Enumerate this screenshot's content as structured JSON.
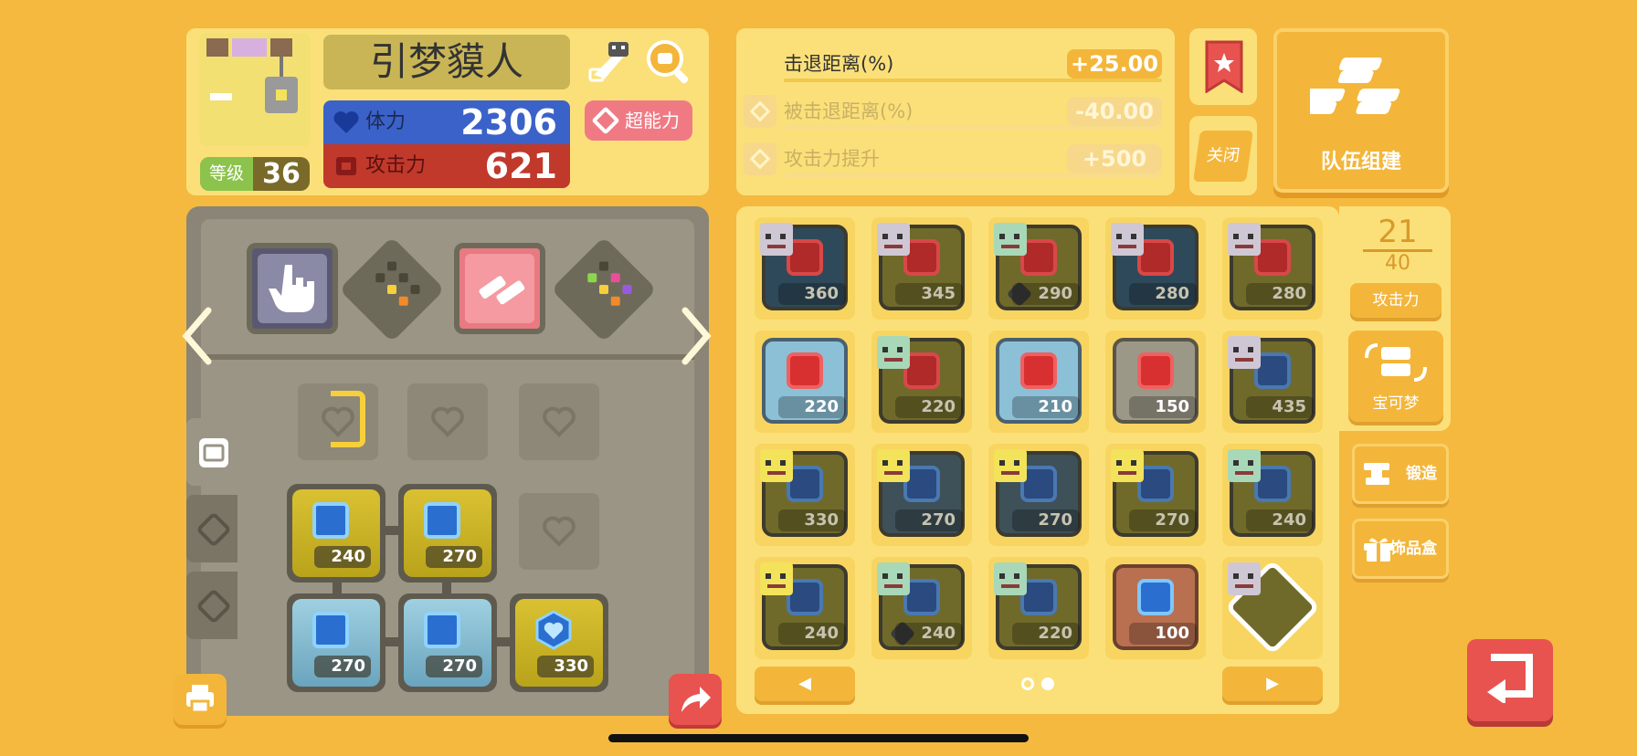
{
  "profile": {
    "name": "引梦貘人",
    "level_label": "等级",
    "level": "36",
    "hp_label": "体力",
    "hp": "2306",
    "atk_label": "攻击力",
    "atk": "621",
    "psychic_label": "超能力"
  },
  "skills": [
    {
      "label": "击退距离(%)",
      "value": "+25.00",
      "active": true
    },
    {
      "label": "被击退距离(%)",
      "value": "-40.00",
      "active": false
    },
    {
      "label": "攻击力提升",
      "value": "+500",
      "active": false
    }
  ],
  "buttons": {
    "close": "关闭",
    "team_build": "队伍组建",
    "attack_sort": "攻击力",
    "pokemon": "宝可梦",
    "forge": "锻造",
    "accessory_box": "饰品盒",
    "prev_page": "◀",
    "next_page": "▶"
  },
  "slot_counter": {
    "used": "21",
    "total": "40"
  },
  "board": {
    "equipped": [
      {
        "value": "240",
        "type": "gold"
      },
      {
        "value": "270",
        "type": "gold"
      },
      {
        "value": "270",
        "type": "blue"
      },
      {
        "value": "270",
        "type": "blue"
      },
      {
        "value": "330",
        "type": "gold-hex"
      }
    ]
  },
  "stones": [
    {
      "value": "360",
      "bg": "dark-navy",
      "icon": "red",
      "owner": "pk-grey",
      "faded": true
    },
    {
      "value": "345",
      "bg": "olive",
      "icon": "red",
      "owner": "pk-grey",
      "faded": true
    },
    {
      "value": "290",
      "bg": "olive",
      "icon": "red",
      "owner": "pk-green",
      "faded": true,
      "badge": true
    },
    {
      "value": "280",
      "bg": "dark-navy",
      "icon": "red",
      "owner": "pk-grey",
      "faded": true
    },
    {
      "value": "280",
      "bg": "olive",
      "icon": "red",
      "owner": "pk-grey",
      "faded": true
    },
    {
      "value": "220",
      "bg": "light-blue",
      "icon": "red-bright",
      "owner": "",
      "faded": false
    },
    {
      "value": "220",
      "bg": "olive",
      "icon": "red",
      "owner": "pk-green",
      "faded": true
    },
    {
      "value": "210",
      "bg": "light-blue",
      "icon": "red-bright",
      "owner": "",
      "faded": false
    },
    {
      "value": "150",
      "bg": "grey",
      "icon": "red-bright",
      "owner": "",
      "faded": false
    },
    {
      "value": "435",
      "bg": "olive",
      "icon": "blue-dim",
      "owner": "pk-grey",
      "faded": true
    },
    {
      "value": "330",
      "bg": "olive",
      "icon": "blue-dim",
      "owner": "pk-yellow",
      "faded": true
    },
    {
      "value": "270",
      "bg": "navy-olive",
      "icon": "blue-dim",
      "owner": "pk-yellow",
      "faded": true
    },
    {
      "value": "270",
      "bg": "navy-olive",
      "icon": "blue-dim",
      "owner": "pk-yellow",
      "faded": true
    },
    {
      "value": "270",
      "bg": "olive",
      "icon": "blue-dim",
      "owner": "pk-yellow",
      "faded": true
    },
    {
      "value": "240",
      "bg": "olive",
      "icon": "blue-dim",
      "owner": "pk-green",
      "faded": true
    },
    {
      "value": "240",
      "bg": "olive",
      "icon": "blue-dim",
      "owner": "pk-yellow",
      "faded": true
    },
    {
      "value": "240",
      "bg": "olive",
      "icon": "blue-dim",
      "owner": "pk-green",
      "faded": true,
      "badge": true
    },
    {
      "value": "220",
      "bg": "olive",
      "icon": "blue-dim",
      "owner": "pk-green",
      "faded": true
    },
    {
      "value": "100",
      "bg": "copper",
      "icon": "blue",
      "owner": "",
      "faded": false
    },
    {
      "value": "",
      "bg": "special",
      "icon": "",
      "owner": "pk-grey",
      "faded": false
    }
  ],
  "pagination": {
    "current": 2,
    "total": 2
  },
  "colors": {
    "background": "#f4b93e",
    "panel": "#fbe07a",
    "hp": "#3b62c9",
    "attack": "#c0392b",
    "psychic": "#f07a84",
    "back_button": "#e8534f"
  }
}
